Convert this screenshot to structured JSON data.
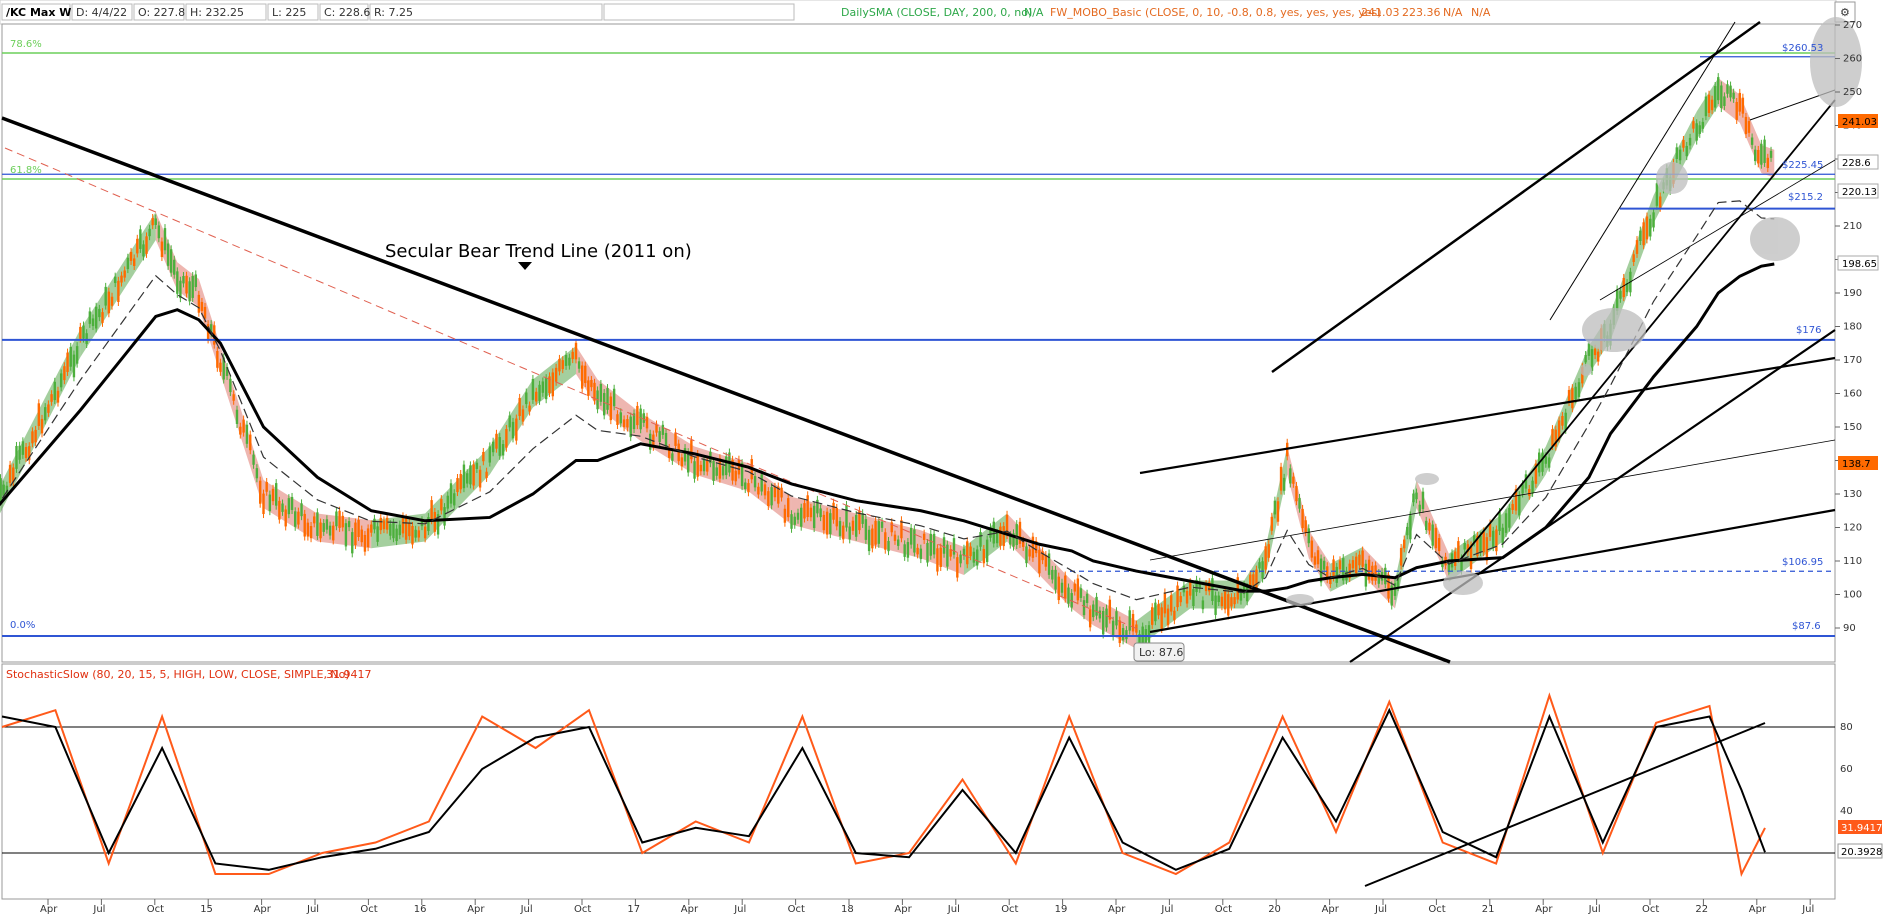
{
  "header": {
    "symbol": "/KC Max W",
    "date": "D: 4/4/22",
    "open": "O: 227.8",
    "high": "H: 232.25",
    "low": "L: 225",
    "close": "C: 228.6",
    "range": "R: 7.25",
    "sma_study": "DailySMA (CLOSE, DAY, 200, 0, no)",
    "sma_value": "N/A",
    "mobo_study": "FW_MOBO_Basic (CLOSE, 0, 10, -0.8, 0.8, yes, yes, yes, yes)",
    "mobo_v1": "241.03",
    "mobo_v2": "223.36",
    "mobo_v3": "N/A",
    "mobo_v4": "N/A"
  },
  "annotation": "Secular Bear Trend Line (2011 on)",
  "low_label": "Lo: 87.6",
  "fib_labels": [
    "78.6%",
    "61.8%",
    "0.0%"
  ],
  "level_labels": [
    "$260.53",
    "$225.45",
    "$215.2",
    "$176",
    "$106.95",
    "$87.6"
  ],
  "price_badges": {
    "last_high": "241.03",
    "close": "228.6",
    "mobo_low": "220.13",
    "sma": "198.65",
    "lower": "138.7"
  },
  "stoch": {
    "title": "StochasticSlow (80, 20, 15, 5, HIGH, LOW, CLOSE, SIMPLE, No)",
    "value": "31.9417",
    "badge_k": "31.9417",
    "badge_d": "20.3928"
  },
  "colors": {
    "background": "#ffffff",
    "candle": "#4caf3c",
    "candle_down": "#ff6a00",
    "band_up": "#5aa84f",
    "band_down": "#e07a6f",
    "level_line": "#2f55d4",
    "fib_line": "#6ccf5a",
    "stoch_k": "#ff5a1a",
    "stoch_d": "#000000",
    "header_sma": "#2ea84a",
    "header_mobo": "#e46a20"
  },
  "chart_data": [
    {
      "type": "line",
      "title": "/KC Max W",
      "x_ticks": [
        "Apr",
        "Jul",
        "Oct",
        "15",
        "Apr",
        "Jul",
        "Oct",
        "16",
        "Apr",
        "Jul",
        "Oct",
        "17",
        "Apr",
        "Jul",
        "Oct",
        "18",
        "Apr",
        "Jul",
        "Oct",
        "19",
        "Apr",
        "Jul",
        "Oct",
        "20",
        "Apr",
        "Jul",
        "Oct",
        "21",
        "Apr",
        "Jul",
        "Oct",
        "22",
        "Apr",
        "Jul"
      ],
      "y_ticks": [
        90,
        100,
        110,
        120,
        130,
        140,
        150,
        160,
        170,
        180,
        190,
        200,
        210,
        220,
        230,
        240,
        250,
        260,
        270
      ],
      "ylim": [
        80,
        272
      ],
      "x": [
        2014.0,
        2014.4,
        2014.65,
        2014.75,
        2014.85,
        2014.95,
        2015.05,
        2015.25,
        2015.5,
        2015.75,
        2016.0,
        2016.3,
        2016.5,
        2016.7,
        2016.8,
        2017.0,
        2017.25,
        2017.5,
        2017.7,
        2018.0,
        2018.3,
        2018.5,
        2018.7,
        2018.85,
        2019.0,
        2019.1,
        2019.3,
        2019.55,
        2019.8,
        2019.9,
        2020.0,
        2020.1,
        2020.2,
        2020.35,
        2020.5,
        2020.6,
        2020.75,
        2021.0,
        2021.2,
        2021.4,
        2021.5,
        2021.7,
        2021.9,
        2022.0,
        2022.1,
        2022.2,
        2022.26
      ],
      "series": [
        {
          "values": [
            125,
            175,
            200,
            210,
            195,
            190,
            170,
            130,
            120,
            118,
            120,
            140,
            160,
            170,
            160,
            150,
            140,
            135,
            125,
            120,
            115,
            110,
            120,
            110,
            100,
            95,
            88,
            100,
            100,
            110,
            140,
            115,
            105,
            110,
            100,
            130,
            108,
            120,
            140,
            170,
            180,
            215,
            240,
            250,
            245,
            230,
            228.6
          ]
        },
        {
          "name": "DailySMA",
          "values": [
            125,
            155,
            175,
            183,
            185,
            182,
            175,
            150,
            135,
            125,
            122,
            123,
            130,
            140,
            140,
            145,
            142,
            138,
            133,
            128,
            125,
            122,
            118,
            115,
            113,
            110,
            107,
            104,
            101,
            101,
            102,
            104,
            105,
            106,
            105,
            108,
            110,
            111,
            120,
            135,
            148,
            165,
            180,
            190,
            195,
            198,
            198.65
          ]
        }
      ],
      "horizontal_levels": [
        260.53,
        225.45,
        215.2,
        176,
        106.95,
        87.6
      ]
    },
    {
      "type": "line",
      "title": "StochasticSlow (80, 20, 15, 5, HIGH, LOW, CLOSE, SIMPLE, No)",
      "y_ticks": [
        20,
        40,
        60,
        80
      ],
      "ylim": [
        0,
        100
      ],
      "reference_lines": [
        80,
        20
      ],
      "x": [
        2014.0,
        2014.25,
        2014.5,
        2014.75,
        2015.0,
        2015.25,
        2015.5,
        2015.75,
        2016.0,
        2016.25,
        2016.5,
        2016.75,
        2017.0,
        2017.25,
        2017.5,
        2017.75,
        2018.0,
        2018.25,
        2018.5,
        2018.75,
        2019.0,
        2019.25,
        2019.5,
        2019.75,
        2020.0,
        2020.25,
        2020.5,
        2020.75,
        2021.0,
        2021.25,
        2021.5,
        2021.75,
        2022.0,
        2022.15,
        2022.26
      ],
      "series": [
        {
          "values": [
            80,
            88,
            15,
            85,
            10,
            10,
            20,
            25,
            35,
            85,
            70,
            88,
            20,
            35,
            25,
            85,
            15,
            20,
            55,
            15,
            85,
            20,
            10,
            25,
            85,
            30,
            92,
            25,
            15,
            95,
            20,
            82,
            90,
            10,
            31.9417
          ]
        },
        {
          "values": [
            85,
            80,
            20,
            70,
            15,
            12,
            18,
            22,
            30,
            60,
            75,
            80,
            25,
            32,
            28,
            70,
            20,
            18,
            50,
            20,
            75,
            25,
            12,
            22,
            75,
            35,
            88,
            30,
            18,
            85,
            25,
            80,
            85,
            50,
            20.3928
          ]
        }
      ]
    }
  ]
}
